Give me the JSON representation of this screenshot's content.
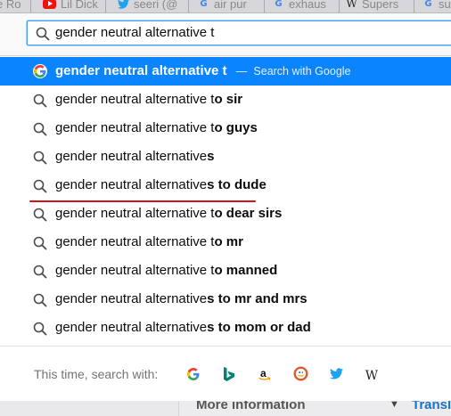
{
  "tabs": [
    {
      "label": "e Ro",
      "icon": "ghost-favicon"
    },
    {
      "label": "Lil Dick",
      "icon": "youtube-icon"
    },
    {
      "label": "seeri (@",
      "icon": "twitter-icon"
    },
    {
      "label": "air pur",
      "icon": "google-icon"
    },
    {
      "label": "exhaus",
      "icon": "google-icon"
    },
    {
      "label": "Supers",
      "icon": "wikipedia-icon"
    },
    {
      "label": "su",
      "icon": "google-icon"
    }
  ],
  "urlbar": {
    "value": "gender neutral alternative t",
    "icon": "search-icon"
  },
  "selected_suggestion": {
    "text": "gender neutral alternative t",
    "separator": "—",
    "action": "Search with Google",
    "icon": "google-icon"
  },
  "suggestions": [
    {
      "typed": "gender neutral alternative t",
      "completion": "o sir"
    },
    {
      "typed": "gender neutral alternative t",
      "completion": "o guys"
    },
    {
      "typed": "gender neutral alternative",
      "completion": "s"
    },
    {
      "typed": "gender neutral alternative",
      "completion": "s to dude"
    },
    {
      "typed": "gender neutral alternative t",
      "completion": "o dear sirs"
    },
    {
      "typed": "gender neutral alternative t",
      "completion": "o mr"
    },
    {
      "typed": "gender neutral alternative t",
      "completion": "o manned"
    },
    {
      "typed": "gender neutral alternative",
      "completion": "s to mr and mrs"
    },
    {
      "typed": "gender neutral alternative",
      "completion": "s to mom or dad"
    }
  ],
  "one_off": {
    "label": "This time, search with:",
    "engines": [
      {
        "name": "google",
        "icon": "google-icon",
        "glyph": "G"
      },
      {
        "name": "bing",
        "icon": "bing-icon",
        "glyph": "b"
      },
      {
        "name": "amazon",
        "icon": "amazon-icon",
        "glyph": "a"
      },
      {
        "name": "duckduckgo",
        "icon": "duckduckgo-icon",
        "glyph": "D"
      },
      {
        "name": "twitter",
        "icon": "twitter-icon",
        "glyph": ""
      },
      {
        "name": "wikipedia",
        "icon": "wikipedia-icon",
        "glyph": "W"
      }
    ]
  },
  "page_under": {
    "heading": "More information",
    "link": "Transl"
  },
  "colors": {
    "selection": "#0a84ff",
    "underline_annotation": "#d31414",
    "google_blue": "#4285f4",
    "bing_teal": "#008373",
    "duckduckgo_orange": "#de5833",
    "twitter_blue": "#1da1f2"
  }
}
